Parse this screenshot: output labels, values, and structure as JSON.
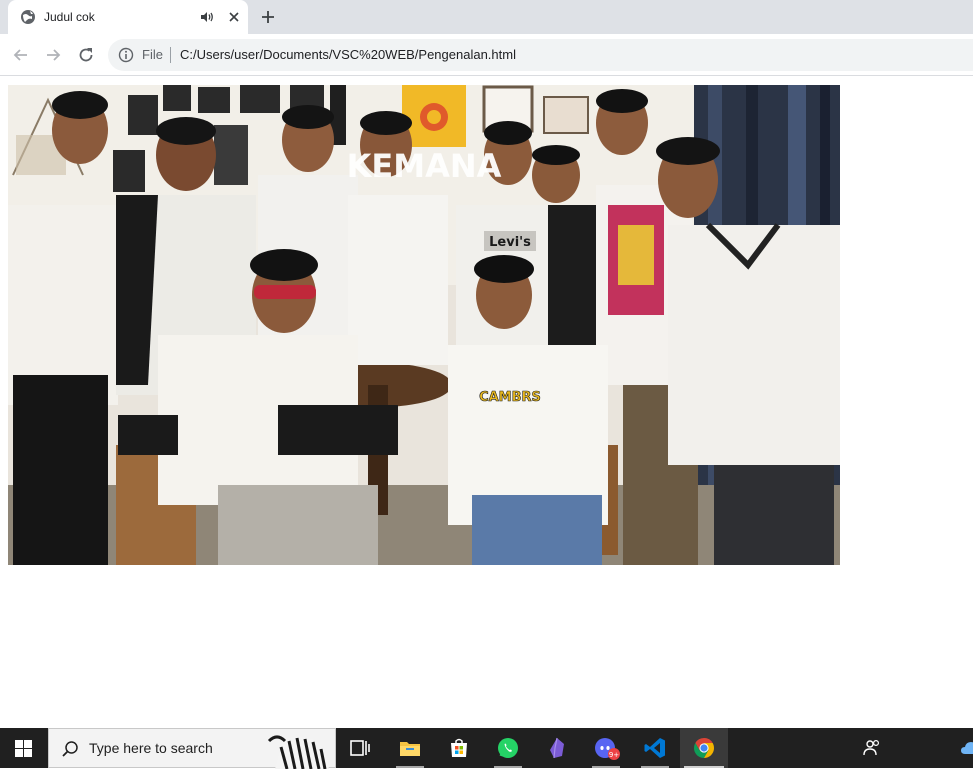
{
  "browser": {
    "tab": {
      "title": "Judul cok",
      "favicon": "globe-icon",
      "audio_icon": "speaker-icon",
      "close_icon": "close-icon"
    },
    "new_tab_icon": "plus-icon",
    "toolbar": {
      "back_icon": "back-arrow-icon",
      "forward_icon": "forward-arrow-icon",
      "reload_icon": "reload-icon",
      "site_info_icon": "info-icon",
      "scheme_label": "File",
      "url": "C:/Users/user/Documents/VSC%20WEB/Pengenalan.html"
    }
  },
  "page": {
    "photo": {
      "caption_overlay": "KEMANA",
      "shirt_text_1": "Levi's",
      "shirt_text_2": "CAMBRS"
    }
  },
  "taskbar": {
    "search_placeholder": "Type here to search",
    "apps": [
      {
        "name": "task-view",
        "icon": "task-view-icon"
      },
      {
        "name": "file-explorer",
        "icon": "folder-icon"
      },
      {
        "name": "microsoft-store",
        "icon": "store-icon"
      },
      {
        "name": "whatsapp",
        "icon": "whatsapp-icon"
      },
      {
        "name": "obsidian",
        "icon": "obsidian-icon"
      },
      {
        "name": "discord",
        "icon": "discord-icon",
        "badge": "9+"
      },
      {
        "name": "vs-code",
        "icon": "vscode-icon"
      },
      {
        "name": "chrome",
        "icon": "chrome-icon"
      }
    ]
  },
  "colors": {
    "tabstrip": "#dee1e6",
    "omnibox": "#f1f3f4",
    "taskbar": "#202020",
    "whatsapp": "#25d366",
    "vscode": "#0078d4",
    "discord": "#5865f2",
    "obsidian": "#7c5cd6"
  }
}
